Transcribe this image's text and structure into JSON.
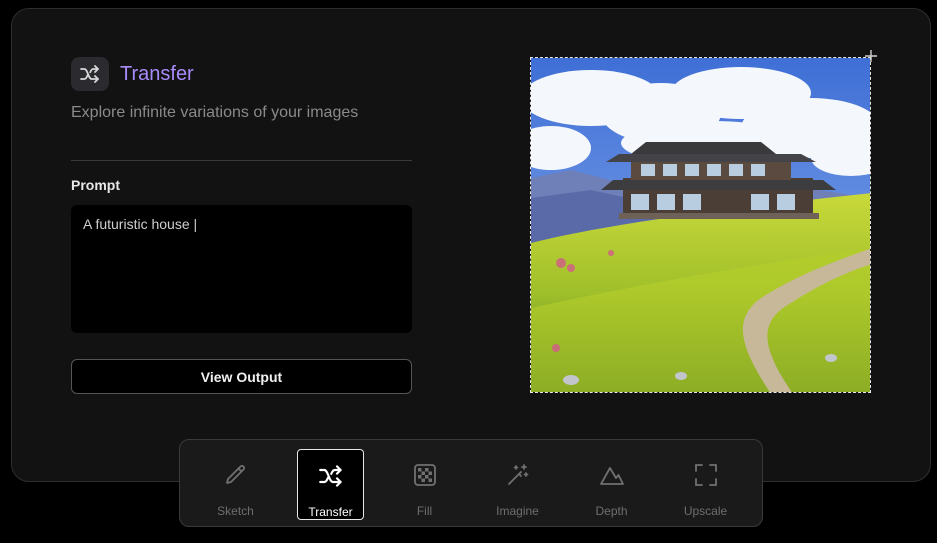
{
  "panel": {
    "title": "Transfer",
    "title_icon": "shuffle-icon",
    "subtitle": "Explore infinite variations of your images",
    "prompt_label": "Prompt",
    "prompt_value": "A futuristic house |",
    "view_output_label": "View Output"
  },
  "preview": {
    "image_description": "anime-style house on a grassy hill"
  },
  "toolbar": {
    "active": "Transfer",
    "tools": [
      {
        "label": "Sketch",
        "icon": "pencil-icon"
      },
      {
        "label": "Transfer",
        "icon": "shuffle-icon"
      },
      {
        "label": "Fill",
        "icon": "checkerboard-icon"
      },
      {
        "label": "Imagine",
        "icon": "magic-wand-icon"
      },
      {
        "label": "Depth",
        "icon": "mountain-icon"
      },
      {
        "label": "Upscale",
        "icon": "expand-corners-icon"
      }
    ]
  },
  "colors": {
    "accent": "#a78bfa",
    "background": "#121212"
  }
}
